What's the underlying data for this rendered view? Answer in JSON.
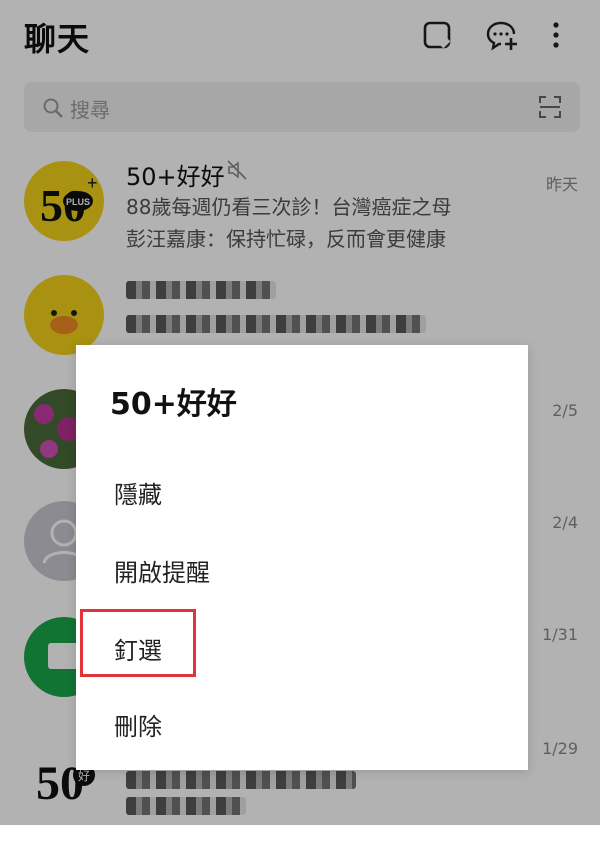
{
  "header": {
    "title": "聊天",
    "icons": [
      "note-icon",
      "add-chat-icon",
      "more-icon"
    ]
  },
  "search": {
    "placeholder": "搜尋"
  },
  "chats": [
    {
      "name": "50+好好",
      "muted": true,
      "lines": [
        "88歲每週仍看三次診！台灣癌症之母",
        "彭汪嘉康：保持忙碌，反而會更健康"
      ],
      "time": "昨天",
      "avatar_label": "50",
      "avatar_sub": "PLUS"
    },
    {
      "name": "",
      "lines": [],
      "time": ""
    },
    {
      "name": "",
      "lines": [],
      "time": "2/5"
    },
    {
      "name": "",
      "lines": [],
      "time": "2/4"
    },
    {
      "name": "",
      "lines": [],
      "time": "1/31"
    },
    {
      "name": "",
      "lines": [],
      "time": "1/29",
      "avatar_label": "50",
      "avatar_sub": "好"
    }
  ],
  "dialog": {
    "title": "50+好好",
    "items": [
      "隱藏",
      "開啟提醒",
      "釘選",
      "刪除"
    ],
    "highlighted": "釘選"
  },
  "colors": {
    "avatar_yellow": "#f2d21b",
    "avatar_green": "#1aa64a",
    "avatar_gray": "#c8c8d0",
    "highlight_red": "#e0333a"
  }
}
